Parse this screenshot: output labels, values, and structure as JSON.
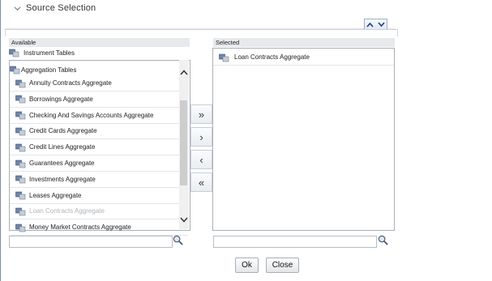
{
  "section": {
    "title": "Source Selection"
  },
  "available": {
    "header": "Available",
    "instrument_group": "Instrument Tables",
    "aggregation_group": "Aggregation Tables",
    "items": [
      {
        "label": "Annuity Contracts Aggregate",
        "disabled": false
      },
      {
        "label": "Borrowings Aggregate",
        "disabled": false
      },
      {
        "label": "Checking And Savings Accounts Aggregate",
        "disabled": false
      },
      {
        "label": "Credit Cards Aggregate",
        "disabled": false
      },
      {
        "label": "Credit Lines Aggregate",
        "disabled": false
      },
      {
        "label": "Guarantees Aggregate",
        "disabled": false
      },
      {
        "label": "Investments Aggregate",
        "disabled": false
      },
      {
        "label": "Leases Aggregate",
        "disabled": false
      },
      {
        "label": "Loan Contracts Aggregate",
        "disabled": true
      },
      {
        "label": "Money Market Contracts Aggregate",
        "disabled": false
      }
    ],
    "search_value": ""
  },
  "selected": {
    "header": "Selected",
    "items": [
      {
        "label": "Loan Contracts Aggregate"
      }
    ],
    "search_value": ""
  },
  "shuttle": {
    "move_all_right": "»",
    "move_right": "›",
    "move_left": "‹",
    "move_all_left": "«"
  },
  "buttons": {
    "ok": "Ok",
    "close": "Close"
  },
  "colors": {
    "disabled_text": "#b0b4b9",
    "border": "#a9b0b8",
    "header_bg": "#e7e9ec"
  }
}
